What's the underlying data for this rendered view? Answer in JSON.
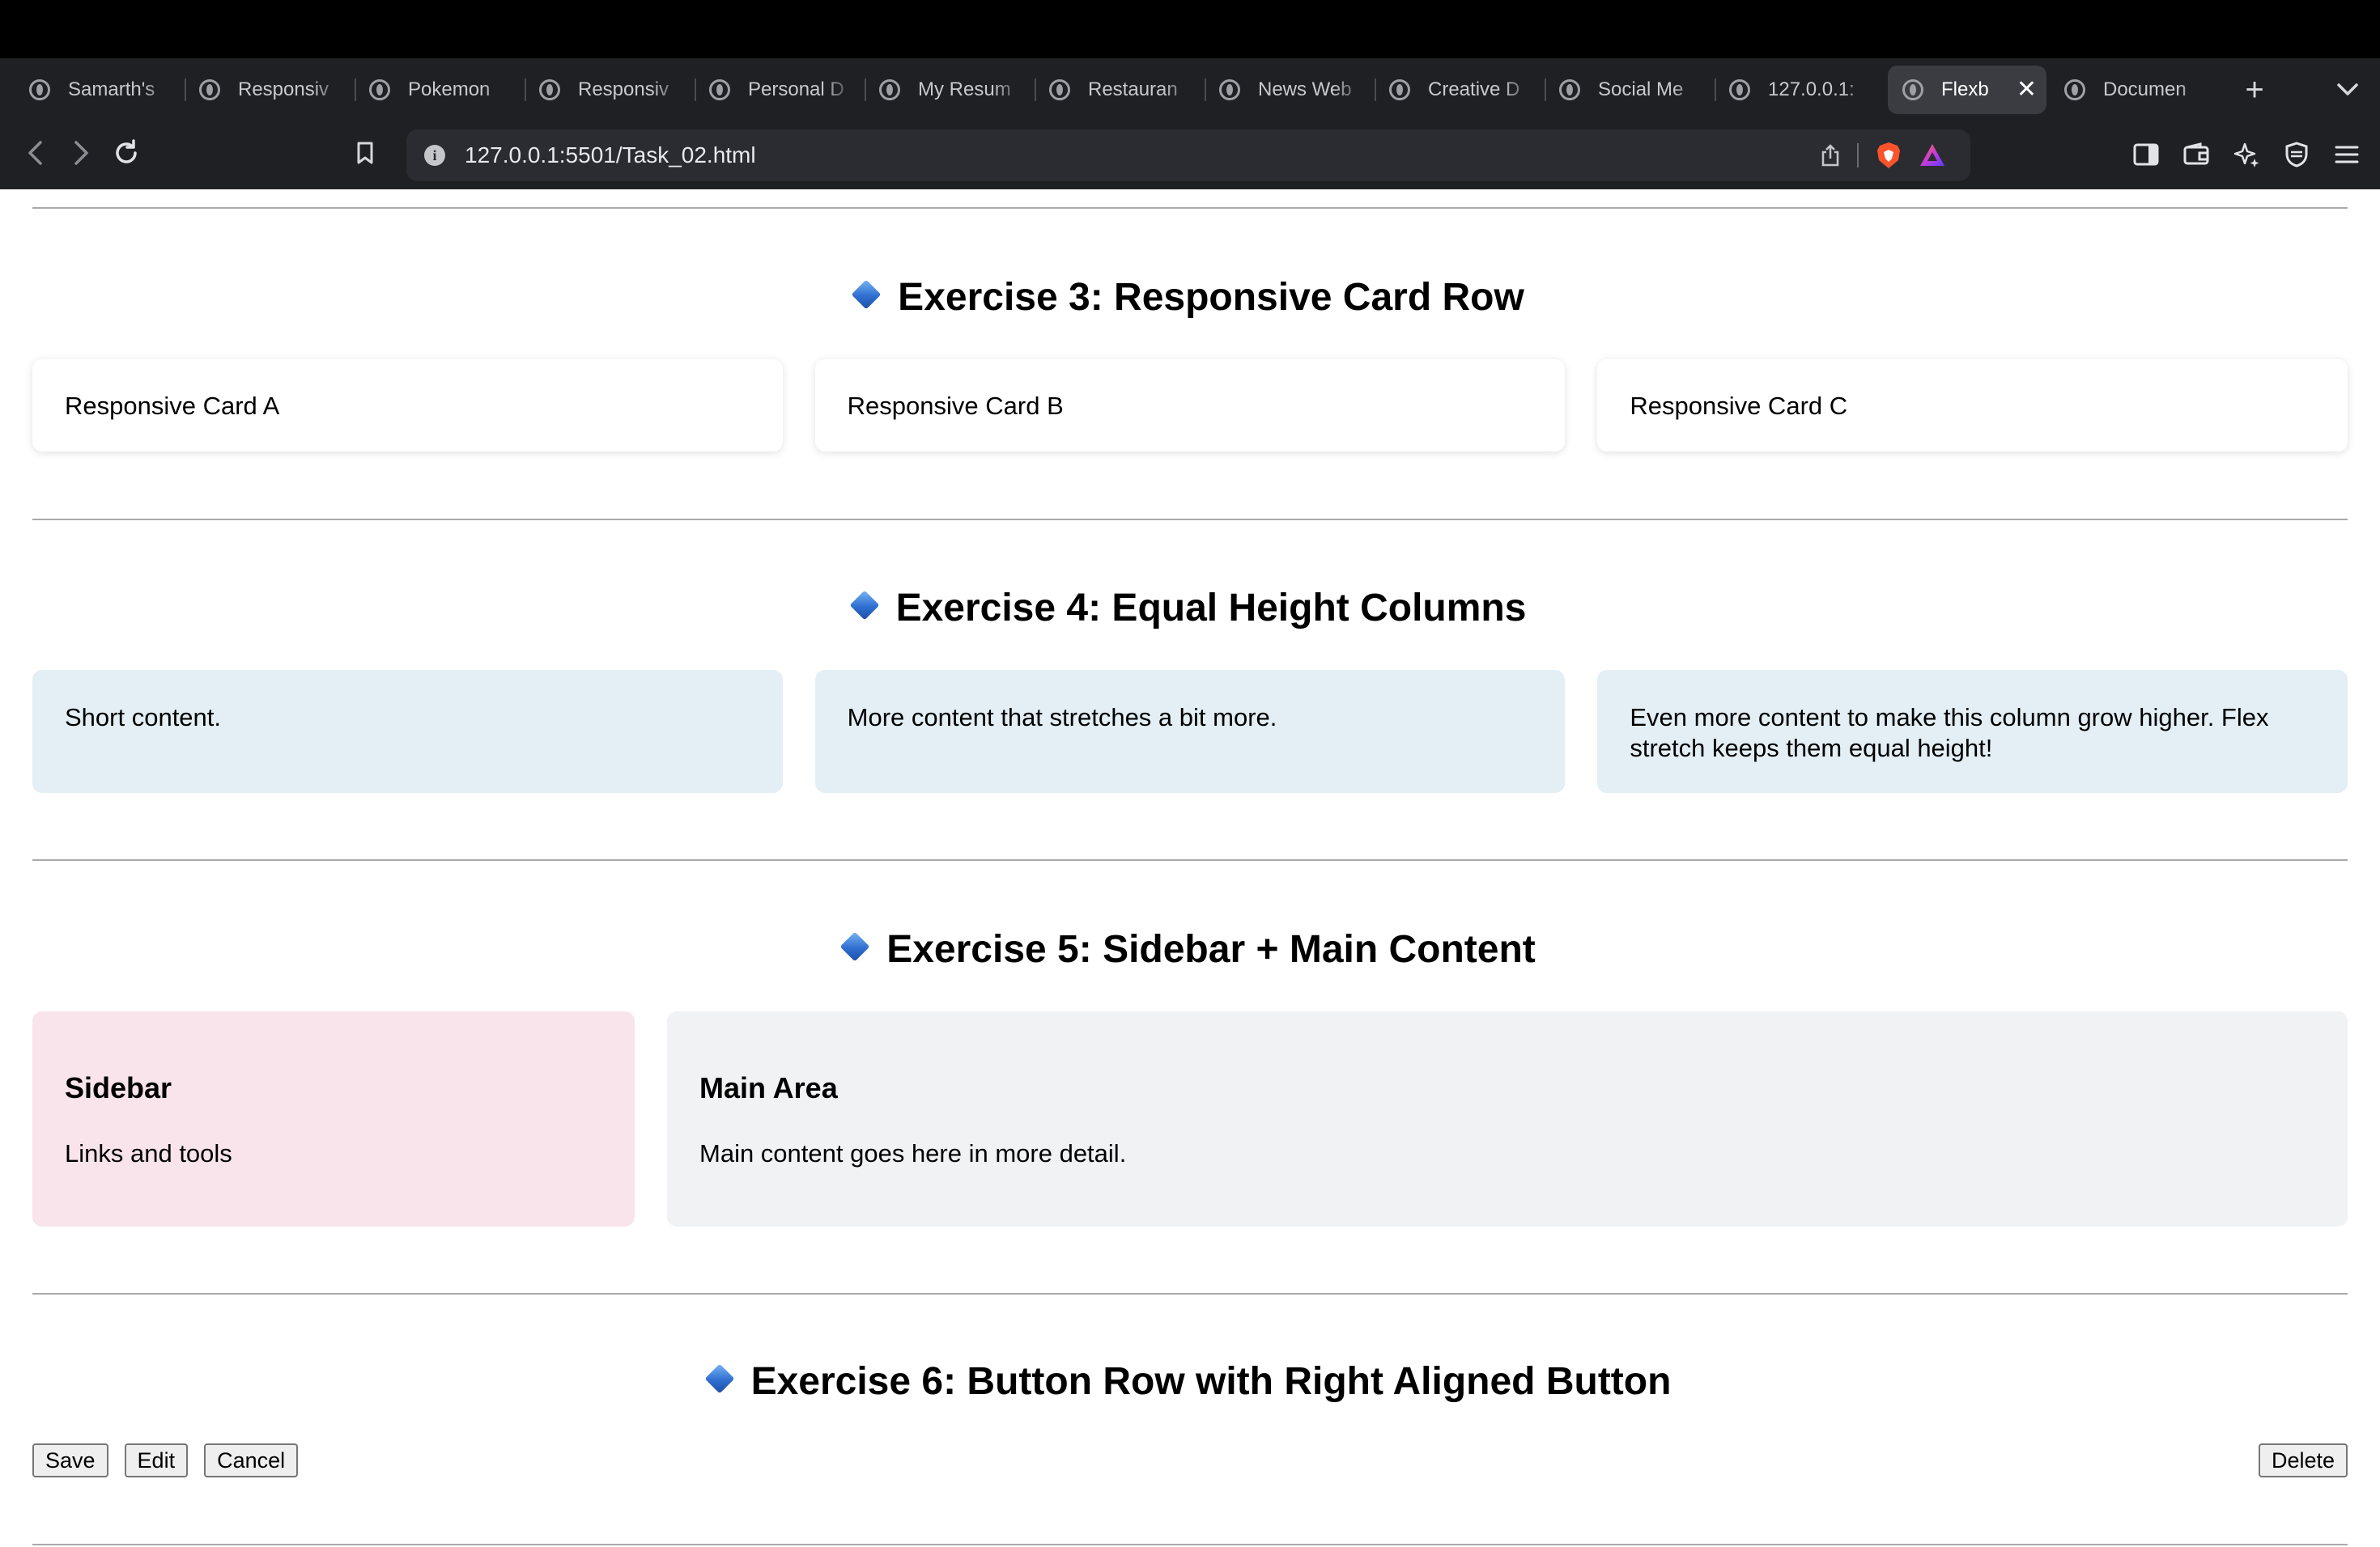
{
  "browser": {
    "tabs": [
      {
        "title": "Samarth's"
      },
      {
        "title": "Responsiv"
      },
      {
        "title": "Pokemon"
      },
      {
        "title": "Responsiv"
      },
      {
        "title": "Personal D"
      },
      {
        "title": "My Resum"
      },
      {
        "title": "Restauran"
      },
      {
        "title": "News Web"
      },
      {
        "title": "Creative D"
      },
      {
        "title": "Social Me"
      },
      {
        "title": "127.0.0.1:"
      },
      {
        "title": "Flexb",
        "active": true
      },
      {
        "title": "Documen"
      }
    ],
    "url": "127.0.0.1:5501/Task_02.html",
    "icons": {
      "globe": "globe-icon",
      "close": "close-icon",
      "new_tab": "plus-icon",
      "back": "chevron-left-icon",
      "forward": "chevron-right-icon",
      "reload": "reload-icon",
      "bookmark": "bookmark-icon",
      "info": "info-icon",
      "share": "share-icon",
      "brave": "brave-shield-icon",
      "rewards": "triangle-icon",
      "sidebar": "sidebar-icon",
      "wallet": "wallet-icon",
      "leo": "sparkle-icon",
      "vpn": "shield-icon",
      "menu": "hamburger-icon"
    }
  },
  "sections": {
    "ex3": {
      "title": "Exercise 3: Responsive Card Row",
      "cards": [
        "Responsive Card A",
        "Responsive Card B",
        "Responsive Card C"
      ]
    },
    "ex4": {
      "title": "Exercise 4: Equal Height Columns",
      "columns": [
        "Short content.",
        "More content that stretches a bit more.",
        "Even more content to make this column grow higher. Flex stretch keeps them equal height!"
      ]
    },
    "ex5": {
      "title": "Exercise 5: Sidebar + Main Content",
      "sidebar": {
        "title": "Sidebar",
        "text": "Links and tools"
      },
      "main": {
        "title": "Main Area",
        "text": "Main content goes here in more detail."
      }
    },
    "ex6": {
      "title": "Exercise 6: Button Row with Right Aligned Button",
      "buttons": [
        "Save",
        "Edit",
        "Cancel"
      ],
      "right_button": "Delete"
    }
  },
  "colors": {
    "diamond": "#2f6fd0",
    "card_bg": "#ffffff",
    "column_bg": "#e3eff5",
    "sidebar_bg": "#f8e4ea",
    "main_bg": "#f1f2f4"
  }
}
